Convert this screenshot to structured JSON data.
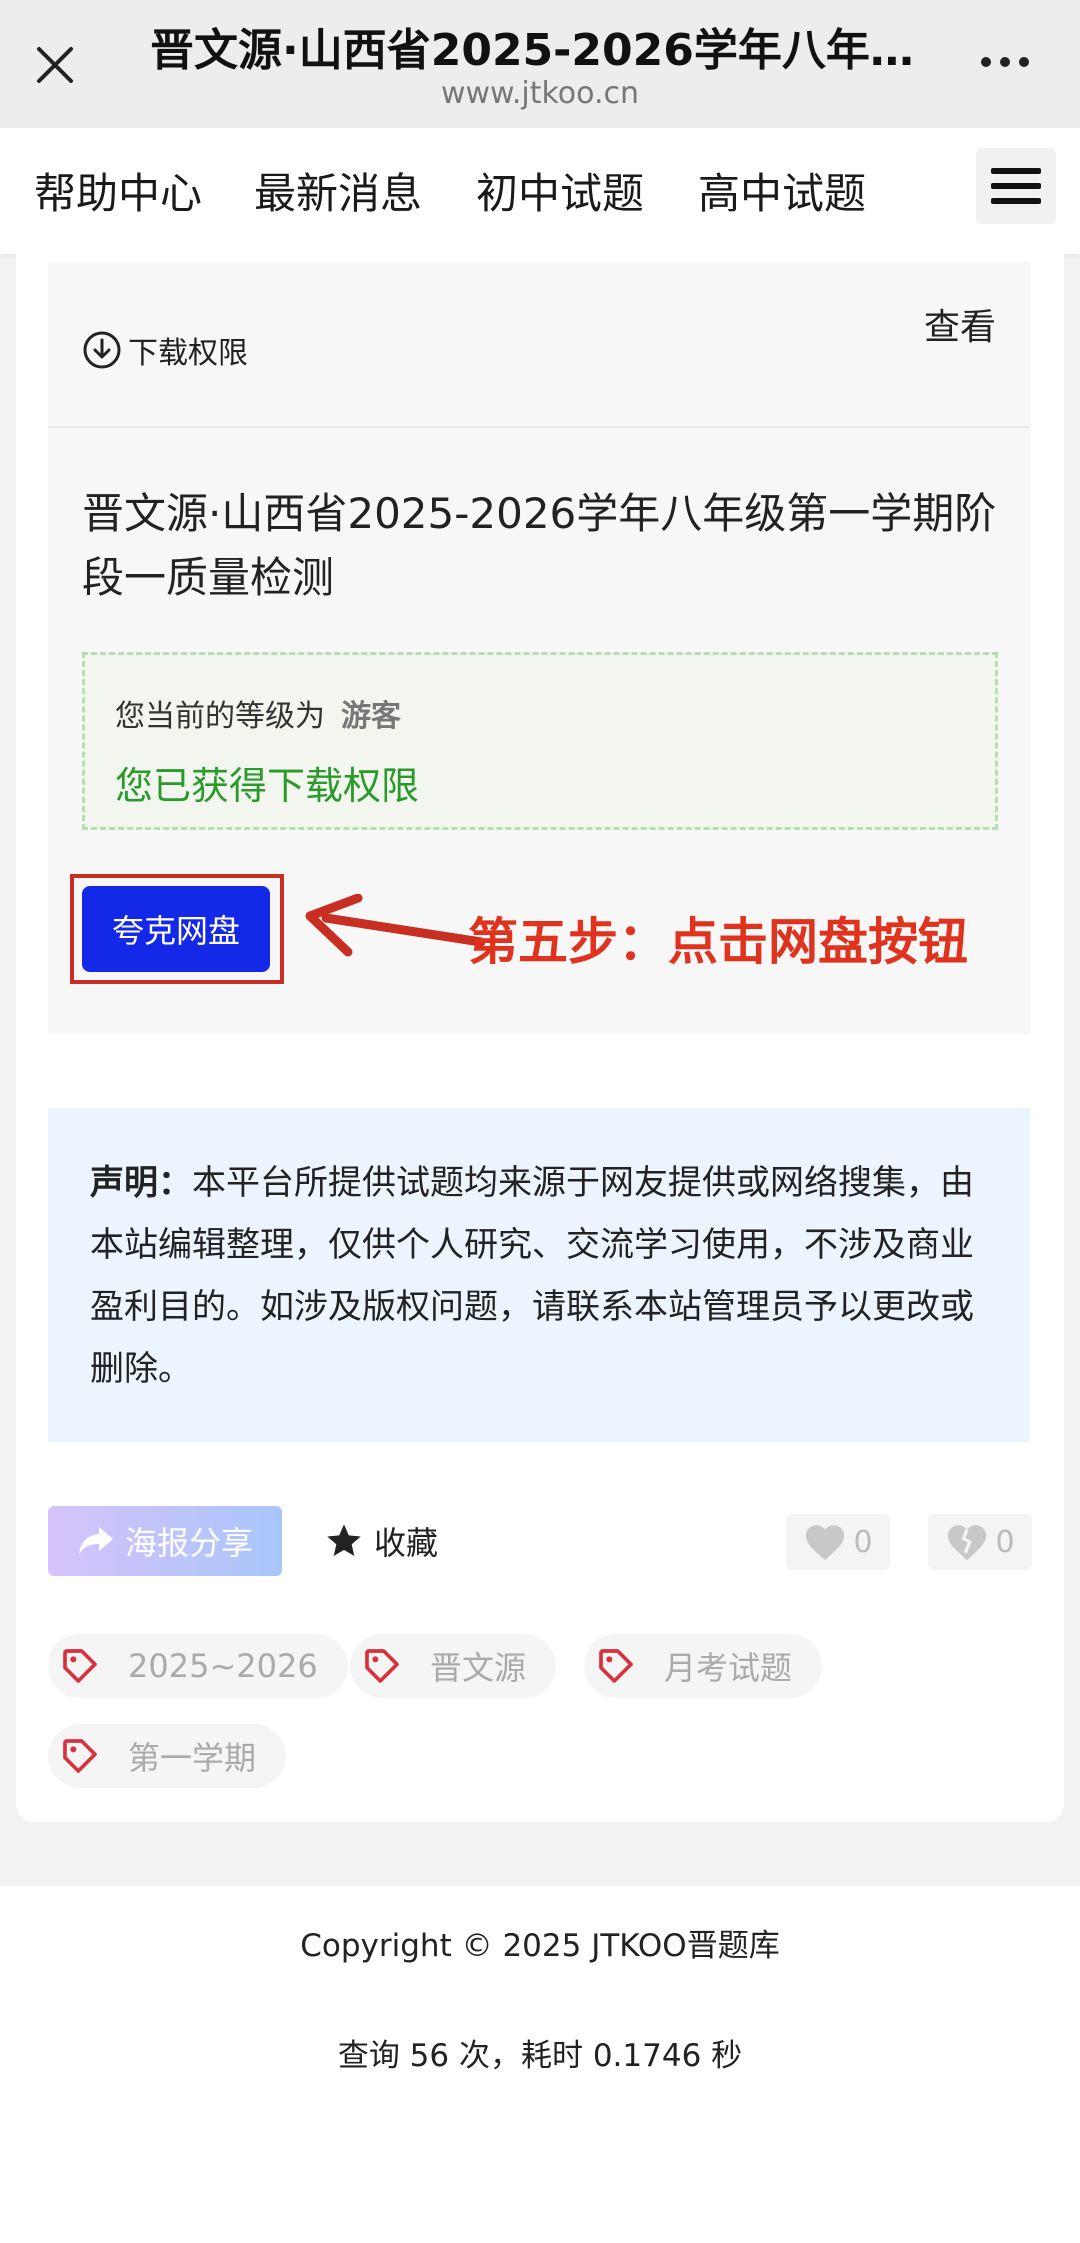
{
  "browser": {
    "title": "晋文源·山西省2025-2026学年八年级第一学期阶段一质量检测",
    "url": "www.jtkoo.cn"
  },
  "nav": {
    "items": [
      "帮助中心",
      "最新消息",
      "初中试题",
      "高中试题"
    ]
  },
  "download": {
    "permission_label": "下载权限",
    "view_label": "查看",
    "doc_title": "晋文源·山西省2025-2026学年八年级第一学期阶段一质量检测",
    "level_prefix": "您当前的等级为",
    "level_value": "游客",
    "granted_text": "您已获得下载权限",
    "pan_button": "夸克网盘",
    "annotation": "第五步：点击网盘按钮"
  },
  "statement": {
    "label": "声明：",
    "text": "本平台所提供试题均来源于网友提供或网络搜集，由本站编辑整理，仅供个人研究、交流学习使用，不涉及商业盈利目的。如涉及版权问题，请联系本站管理员予以更改或删除。"
  },
  "actions": {
    "share": "海报分享",
    "favorite": "收藏",
    "likes": "0",
    "dislikes": "0"
  },
  "tags": [
    "2025~2026",
    "晋文源",
    "月考试题",
    "第一学期"
  ],
  "footer": {
    "copyright": "Copyright © 2025 JTKOO晋题库",
    "stats": "查询 56 次，耗时 0.1746 秒"
  },
  "colors": {
    "pan_button_bg": "#1428e8",
    "annotation": "#e0331e",
    "granted": "#2a9a2a"
  }
}
